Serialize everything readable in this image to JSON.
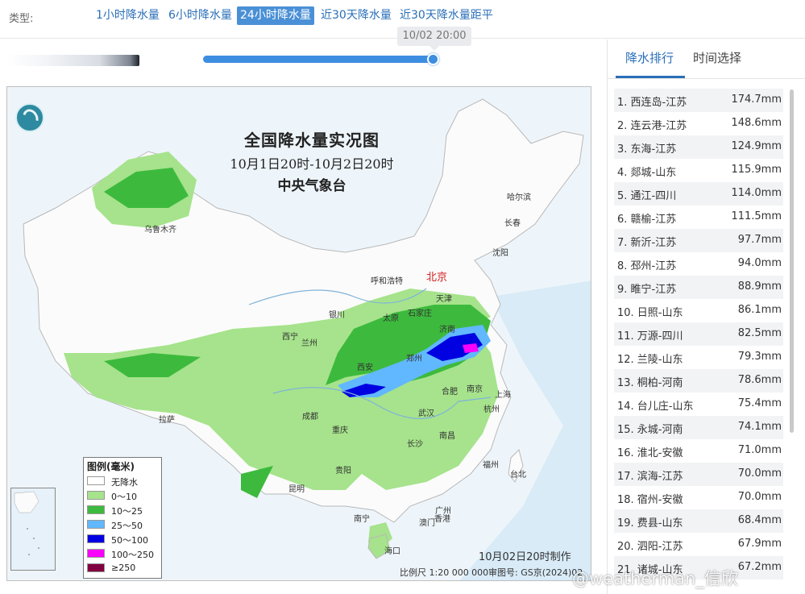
{
  "type_bar": {
    "label": "类型:",
    "options": [
      "1小时降水量",
      "6小时降水量",
      "24小时降水量",
      "近30天降水量",
      "近30天降水量距平"
    ],
    "active_index": 2
  },
  "slider": {
    "tooltip": "10/02 20:00",
    "progress": 1.0
  },
  "map": {
    "title": "全国降水量实况图",
    "subtitle": "10月1日20时-10月2日20时",
    "agency": "中央气象台",
    "made_at": "10月02日20时制作",
    "scale": "比例尺 1:20 000 000",
    "approval": "审图号: GS京(2024)02",
    "cities": [
      "乌鲁木齐",
      "哈尔滨",
      "长春",
      "沈阳",
      "北京",
      "天津",
      "呼和浩特",
      "石家庄",
      "太原",
      "济南",
      "银川",
      "西宁",
      "兰州",
      "西安",
      "郑州",
      "合肥",
      "南京",
      "上海",
      "杭州",
      "武汉",
      "成都",
      "重庆",
      "拉萨",
      "长沙",
      "南昌",
      "福州",
      "台北",
      "贵阳",
      "昆明",
      "南宁",
      "广州",
      "澳门",
      "香港",
      "海口"
    ],
    "legend": {
      "title": "图例(毫米)",
      "items": [
        {
          "label": "无降水",
          "color": "#ffffff"
        },
        {
          "label": "0～10",
          "color": "#a6e38c"
        },
        {
          "label": "10～25",
          "color": "#3dba3d"
        },
        {
          "label": "25～50",
          "color": "#61b8ff"
        },
        {
          "label": "50～100",
          "color": "#0000e0"
        },
        {
          "label": "100～250",
          "color": "#fa00fa"
        },
        {
          "label": "≥250",
          "color": "#800040"
        }
      ]
    }
  },
  "right_panel": {
    "tabs": [
      "降水排行",
      "时间选择"
    ],
    "active_tab": 0,
    "ranking": [
      {
        "name": "1. 西连岛-江苏",
        "value": "174.7mm"
      },
      {
        "name": "2. 连云港-江苏",
        "value": "148.6mm"
      },
      {
        "name": "3. 东海-江苏",
        "value": "124.9mm"
      },
      {
        "name": "4. 郯城-山东",
        "value": "115.9mm"
      },
      {
        "name": "5. 通江-四川",
        "value": "114.0mm"
      },
      {
        "name": "6. 赣榆-江苏",
        "value": "111.5mm"
      },
      {
        "name": "7. 新沂-江苏",
        "value": "97.7mm"
      },
      {
        "name": "8. 邳州-江苏",
        "value": "94.0mm"
      },
      {
        "name": "9. 睢宁-江苏",
        "value": "88.9mm"
      },
      {
        "name": "10. 日照-山东",
        "value": "86.1mm"
      },
      {
        "name": "11. 万源-四川",
        "value": "82.5mm"
      },
      {
        "name": "12. 兰陵-山东",
        "value": "79.3mm"
      },
      {
        "name": "13. 桐柏-河南",
        "value": "78.6mm"
      },
      {
        "name": "14. 台儿庄-山东",
        "value": "75.4mm"
      },
      {
        "name": "15. 永城-河南",
        "value": "74.1mm"
      },
      {
        "name": "16. 淮北-安徽",
        "value": "71.0mm"
      },
      {
        "name": "17. 滨海-江苏",
        "value": "70.0mm"
      },
      {
        "name": "18. 宿州-安徽",
        "value": "70.0mm"
      },
      {
        "name": "19. 费县-山东",
        "value": "68.4mm"
      },
      {
        "name": "20. 泗阳-江苏",
        "value": "67.9mm"
      },
      {
        "name": "21. 诸城-山东",
        "value": "67.2mm"
      }
    ]
  },
  "watermark": "@weatherman_信欣"
}
